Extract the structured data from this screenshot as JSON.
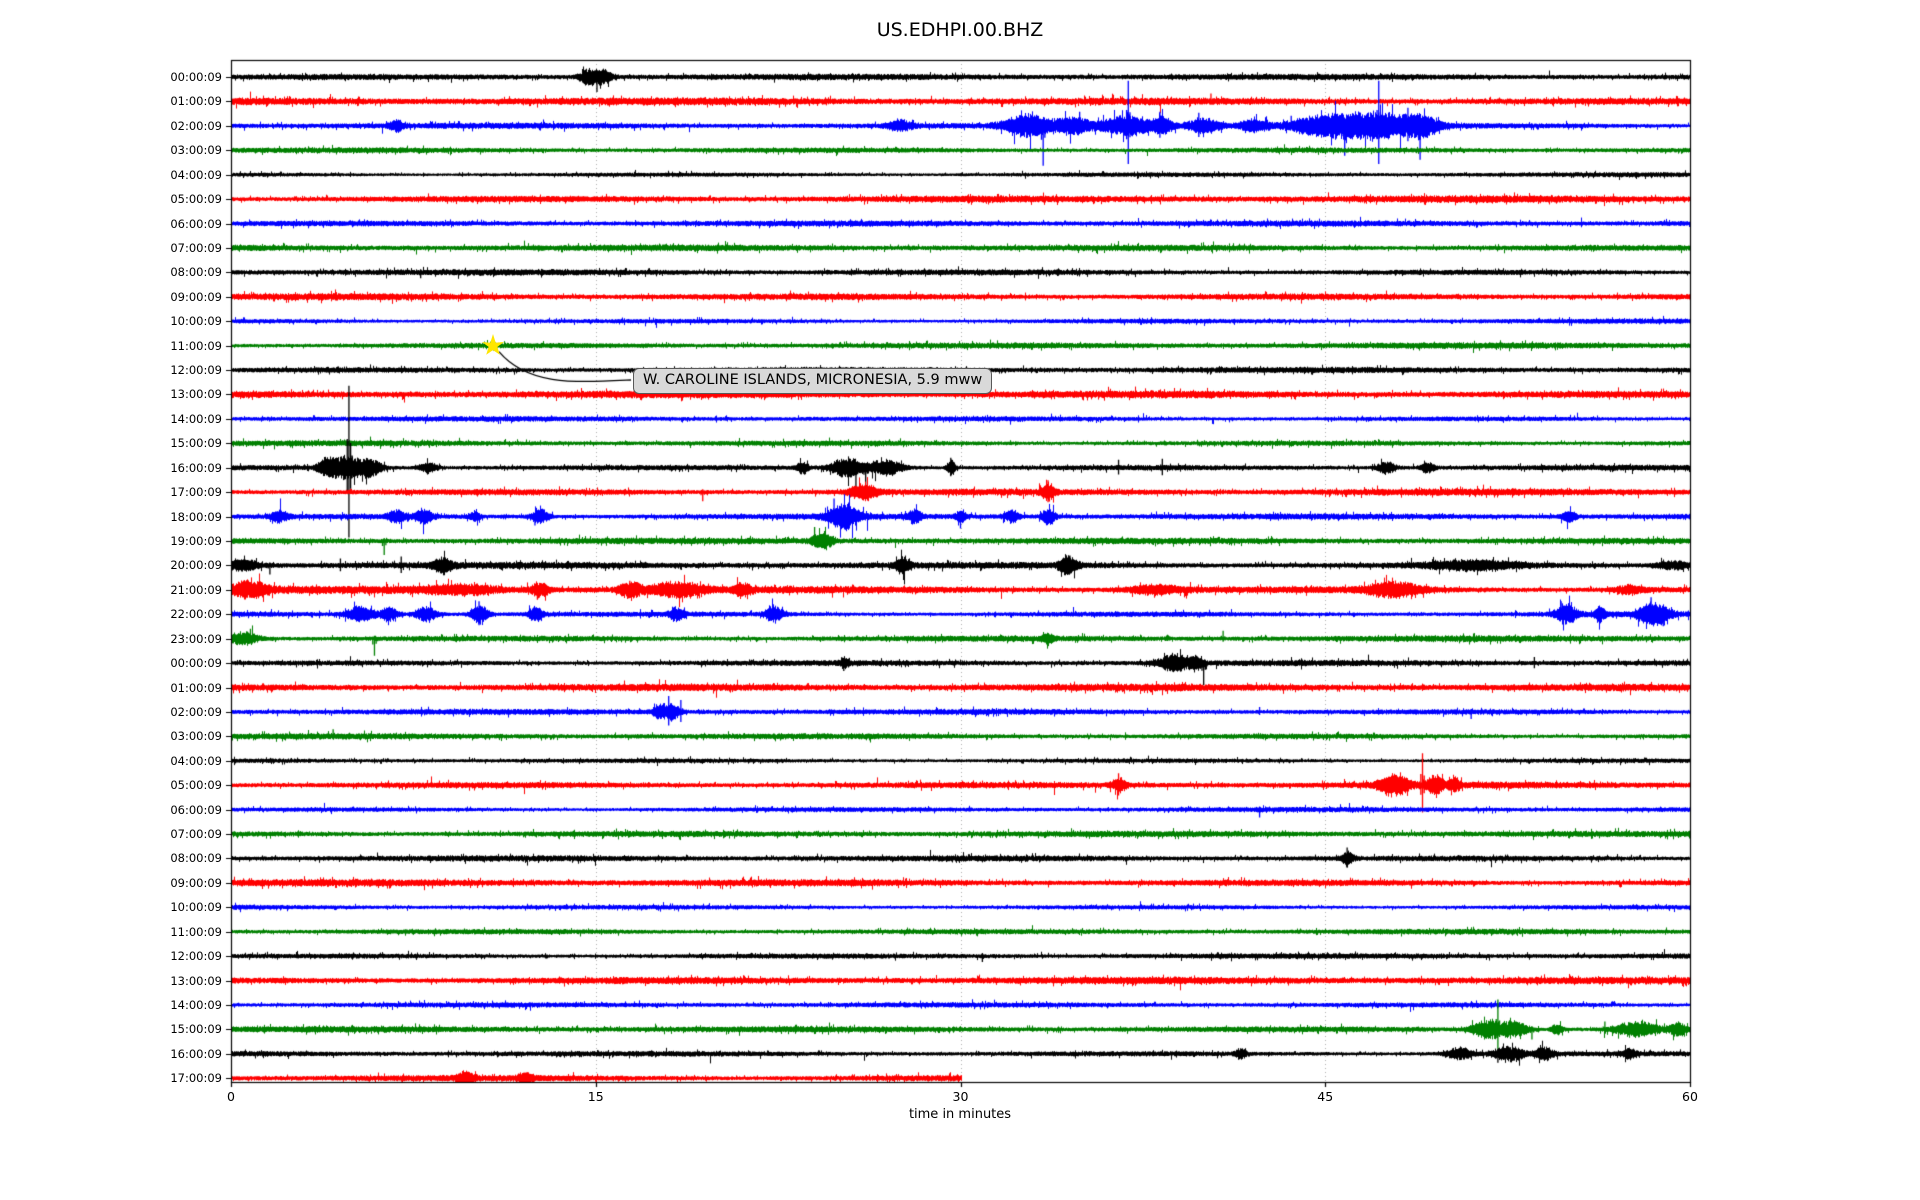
{
  "title": "US.EDHPI.00.BHZ",
  "annotation": {
    "text": "W. CAROLINE ISLANDS, MICRONESIA, 5.9 mww",
    "star_minute": 10.77,
    "star_row": 11
  },
  "axes": {
    "xlabel": "time in minutes",
    "x_ticks": [
      "0",
      "15",
      "30",
      "45",
      "60"
    ],
    "x_tick_minutes": [
      0,
      15,
      30,
      45,
      60
    ],
    "grid_minutes": [
      15,
      30,
      45
    ]
  },
  "colors": {
    "cycle": [
      "#000000",
      "#ff0000",
      "#0000ff",
      "#008000"
    ],
    "grid": "#ababab",
    "axis": "#000000",
    "star_fill": "#ffe600",
    "annotation_bg": "#d9d9d9",
    "annotation_border": "#595959",
    "background": "#ffffff"
  },
  "chart_data": {
    "type": "line",
    "title": "US.EDHPI.00.BHZ",
    "xlabel": "time in minutes",
    "xlim": [
      0,
      60
    ],
    "x_unit": "minutes",
    "row_interval": "1 hour per trace, colors cycle black/red/blue/green",
    "marked_event": {
      "label": "W. CAROLINE ISLANDS, MICRONESIA, 5.9 mww",
      "row": 11,
      "minute": 10.77
    },
    "rows": [
      {
        "label": "00:00:09",
        "color": 0,
        "base": 3.2,
        "xmax": 60,
        "bursts": [
          [
            14.7,
            0.5,
            8
          ],
          [
            15.3,
            0.5,
            7
          ]
        ],
        "spikes": [
          [
            15.05,
            15,
            "down"
          ]
        ]
      },
      {
        "label": "01:00:09",
        "color": 1,
        "base": 4.0,
        "xmax": 60,
        "bursts": [],
        "spikes": [
          [
            40.3,
            8,
            "up"
          ]
        ]
      },
      {
        "label": "02:00:09",
        "color": 2,
        "base": 3.2,
        "xmax": 60,
        "bursts": [
          [
            6.8,
            0.4,
            5
          ],
          [
            27.5,
            0.7,
            5
          ],
          [
            32.8,
            1.4,
            11
          ],
          [
            34.6,
            0.9,
            8
          ],
          [
            36.8,
            1.6,
            10
          ],
          [
            38.3,
            0.6,
            7
          ],
          [
            40.0,
            1.0,
            8
          ],
          [
            42.0,
            0.9,
            6
          ],
          [
            44.8,
            2.0,
            10
          ],
          [
            47.2,
            2.4,
            13
          ],
          [
            49.0,
            0.9,
            8
          ]
        ],
        "spikes": [
          [
            33.4,
            40,
            "down"
          ],
          [
            34.9,
            14,
            "up"
          ],
          [
            36.9,
            45,
            "both"
          ],
          [
            38.2,
            14,
            "both"
          ],
          [
            39.8,
            13,
            "both"
          ],
          [
            43.6,
            10,
            "up"
          ],
          [
            45.5,
            12,
            "both"
          ],
          [
            45.8,
            30,
            "down"
          ],
          [
            47.2,
            45,
            "both"
          ],
          [
            48.4,
            18,
            "both"
          ],
          [
            48.9,
            34,
            "down"
          ]
        ]
      },
      {
        "label": "03:00:09",
        "color": 3,
        "base": 3.2,
        "xmax": 60,
        "bursts": [],
        "spikes": []
      },
      {
        "label": "04:00:09",
        "color": 0,
        "base": 2.6,
        "xmax": 60,
        "bursts": [],
        "spikes": []
      },
      {
        "label": "05:00:09",
        "color": 1,
        "base": 3.8,
        "xmax": 60,
        "bursts": [],
        "spikes": []
      },
      {
        "label": "06:00:09",
        "color": 2,
        "base": 3.1,
        "xmax": 60,
        "bursts": [],
        "spikes": []
      },
      {
        "label": "07:00:09",
        "color": 3,
        "base": 3.3,
        "xmax": 60,
        "bursts": [],
        "spikes": []
      },
      {
        "label": "08:00:09",
        "color": 0,
        "base": 3.3,
        "xmax": 60,
        "bursts": [],
        "spikes": [
          [
            7.8,
            6,
            "down"
          ]
        ]
      },
      {
        "label": "09:00:09",
        "color": 1,
        "base": 3.9,
        "xmax": 60,
        "bursts": [],
        "spikes": []
      },
      {
        "label": "10:00:09",
        "color": 2,
        "base": 2.8,
        "xmax": 60,
        "bursts": [],
        "spikes": []
      },
      {
        "label": "11:00:09",
        "color": 3,
        "base": 3.3,
        "xmax": 60,
        "bursts": [],
        "spikes": []
      },
      {
        "label": "12:00:09",
        "color": 0,
        "base": 3.1,
        "xmax": 60,
        "bursts": [],
        "spikes": []
      },
      {
        "label": "13:00:09",
        "color": 1,
        "base": 3.9,
        "xmax": 60,
        "bursts": [],
        "spikes": []
      },
      {
        "label": "14:00:09",
        "color": 2,
        "base": 2.8,
        "xmax": 60,
        "bursts": [],
        "spikes": []
      },
      {
        "label": "15:00:09",
        "color": 3,
        "base": 3.2,
        "xmax": 60,
        "bursts": [],
        "spikes": []
      },
      {
        "label": "16:00:09",
        "color": 0,
        "base": 3.2,
        "xmax": 60,
        "bursts": [
          [
            3.9,
            0.5,
            8
          ],
          [
            4.7,
            0.8,
            12
          ],
          [
            5.7,
            0.7,
            9
          ],
          [
            8.1,
            0.5,
            5
          ],
          [
            23.5,
            0.3,
            6
          ],
          [
            25.3,
            0.9,
            10
          ],
          [
            26.9,
            1.0,
            8
          ],
          [
            29.6,
            0.25,
            7
          ],
          [
            47.5,
            0.5,
            6
          ],
          [
            49.2,
            0.4,
            5
          ]
        ],
        "spikes": [
          [
            4.85,
            82,
            "both"
          ],
          [
            25.7,
            22,
            "down"
          ],
          [
            26.1,
            20,
            "down"
          ],
          [
            29.6,
            10,
            "both"
          ],
          [
            36.5,
            8,
            "both"
          ],
          [
            38.3,
            9,
            "both"
          ]
        ]
      },
      {
        "label": "17:00:09",
        "color": 1,
        "base": 3.8,
        "xmax": 60,
        "bursts": [
          [
            26.0,
            0.8,
            7
          ],
          [
            33.6,
            0.35,
            8
          ]
        ],
        "spikes": [
          [
            19.4,
            9,
            "down"
          ],
          [
            33.6,
            12,
            "both"
          ]
        ]
      },
      {
        "label": "18:00:09",
        "color": 2,
        "base": 3.1,
        "xmax": 60,
        "bursts": [
          [
            2.0,
            0.5,
            5
          ],
          [
            6.8,
            0.5,
            6
          ],
          [
            7.9,
            0.5,
            7
          ],
          [
            10.0,
            0.3,
            5
          ],
          [
            12.7,
            0.5,
            7
          ],
          [
            25.2,
            0.9,
            12
          ],
          [
            28.1,
            0.4,
            6
          ],
          [
            30.0,
            0.3,
            5
          ],
          [
            32.1,
            0.4,
            6
          ],
          [
            33.6,
            0.4,
            8
          ],
          [
            55.0,
            0.4,
            5
          ]
        ],
        "spikes": [
          [
            12.5,
            9,
            "down"
          ],
          [
            24.8,
            18,
            "up"
          ],
          [
            25.4,
            14,
            "both"
          ],
          [
            30.0,
            12,
            "down"
          ]
        ]
      },
      {
        "label": "19:00:09",
        "color": 3,
        "base": 3.3,
        "xmax": 60,
        "bursts": [
          [
            24.3,
            0.6,
            8
          ]
        ],
        "spikes": [
          [
            6.3,
            14,
            "down"
          ],
          [
            24.0,
            14,
            "up"
          ]
        ]
      },
      {
        "label": "20:00:09",
        "color": 0,
        "base": 3.5,
        "xmax": 60,
        "bursts": [
          [
            0.5,
            0.9,
            5
          ],
          [
            8.7,
            0.5,
            7
          ],
          [
            27.6,
            0.4,
            8
          ],
          [
            34.4,
            0.5,
            9
          ],
          [
            51.0,
            2.5,
            4
          ],
          [
            59.3,
            1.0,
            4
          ]
        ],
        "spikes": [
          [
            1.6,
            9,
            "down"
          ],
          [
            4.5,
            7,
            "both"
          ],
          [
            7.0,
            9,
            "both"
          ],
          [
            34.5,
            10,
            "both"
          ]
        ]
      },
      {
        "label": "21:00:09",
        "color": 1,
        "base": 4.2,
        "xmax": 60,
        "bursts": [
          [
            0.7,
            1.1,
            7
          ],
          [
            9.5,
            2.0,
            4
          ],
          [
            12.7,
            0.5,
            7
          ],
          [
            16.4,
            0.6,
            8
          ],
          [
            18.3,
            1.6,
            7
          ],
          [
            21.0,
            0.5,
            6
          ],
          [
            38.0,
            1.5,
            4
          ],
          [
            47.8,
            1.6,
            7
          ],
          [
            57.5,
            0.8,
            4
          ]
        ],
        "spikes": [
          [
            12.6,
            10,
            "down"
          ],
          [
            16.4,
            9,
            "both"
          ]
        ]
      },
      {
        "label": "22:00:09",
        "color": 2,
        "base": 3.1,
        "xmax": 60,
        "bursts": [
          [
            5.3,
            0.8,
            8
          ],
          [
            6.5,
            0.5,
            7
          ],
          [
            8.0,
            0.6,
            8
          ],
          [
            10.2,
            0.5,
            9
          ],
          [
            12.5,
            0.4,
            7
          ],
          [
            18.3,
            0.4,
            6
          ],
          [
            22.3,
            0.5,
            8
          ],
          [
            54.9,
            0.6,
            10
          ],
          [
            56.3,
            0.3,
            7
          ],
          [
            58.5,
            0.9,
            11
          ]
        ],
        "spikes": [
          [
            10.2,
            13,
            "both"
          ],
          [
            22.3,
            10,
            "up"
          ],
          [
            54.7,
            13,
            "up"
          ],
          [
            58.4,
            17,
            "up"
          ],
          [
            58.9,
            12,
            "down"
          ]
        ]
      },
      {
        "label": "23:00:09",
        "color": 3,
        "base": 3.5,
        "xmax": 60,
        "bursts": [
          [
            0.5,
            0.9,
            6
          ],
          [
            33.6,
            0.3,
            5
          ]
        ],
        "spikes": [
          [
            0.8,
            10,
            "up"
          ],
          [
            5.9,
            17,
            "down"
          ],
          [
            40.8,
            8,
            "up"
          ]
        ]
      },
      {
        "label": "00:00:09",
        "color": 0,
        "base": 3.1,
        "xmax": 60,
        "bursts": [
          [
            25.2,
            0.25,
            5
          ],
          [
            38.8,
            0.9,
            8
          ],
          [
            39.7,
            0.35,
            6
          ]
        ],
        "spikes": [
          [
            25.2,
            8,
            "down"
          ],
          [
            40.0,
            22,
            "down"
          ],
          [
            53.6,
            6,
            "both"
          ]
        ]
      },
      {
        "label": "01:00:09",
        "color": 1,
        "base": 3.8,
        "xmax": 60,
        "bursts": [],
        "spikes": []
      },
      {
        "label": "02:00:09",
        "color": 2,
        "base": 3.0,
        "xmax": 60,
        "bursts": [
          [
            17.6,
            0.35,
            7
          ],
          [
            18.1,
            0.45,
            8
          ]
        ],
        "spikes": [
          [
            18.0,
            16,
            "both"
          ],
          [
            18.5,
            12,
            "both"
          ],
          [
            42.3,
            5,
            "up"
          ],
          [
            51.0,
            7,
            "down"
          ]
        ]
      },
      {
        "label": "03:00:09",
        "color": 3,
        "base": 3.2,
        "xmax": 60,
        "bursts": [],
        "spikes": [
          [
            4.2,
            7,
            "up"
          ]
        ]
      },
      {
        "label": "04:00:09",
        "color": 0,
        "base": 2.7,
        "xmax": 60,
        "bursts": [],
        "spikes": []
      },
      {
        "label": "05:00:09",
        "color": 1,
        "base": 3.8,
        "xmax": 60,
        "bursts": [
          [
            36.5,
            0.4,
            6
          ],
          [
            47.8,
            0.9,
            9
          ],
          [
            49.5,
            0.5,
            8
          ],
          [
            50.3,
            0.3,
            6
          ]
        ],
        "spikes": [
          [
            36.5,
            12,
            "both"
          ],
          [
            49.0,
            32,
            "both"
          ]
        ]
      },
      {
        "label": "06:00:09",
        "color": 2,
        "base": 2.7,
        "xmax": 60,
        "bursts": [],
        "spikes": [
          [
            42.3,
            8,
            "down"
          ]
        ]
      },
      {
        "label": "07:00:09",
        "color": 3,
        "base": 3.2,
        "xmax": 60,
        "bursts": [],
        "spikes": []
      },
      {
        "label": "08:00:09",
        "color": 0,
        "base": 3.1,
        "xmax": 60,
        "bursts": [
          [
            45.9,
            0.35,
            6
          ]
        ],
        "spikes": [
          [
            45.9,
            11,
            "both"
          ]
        ]
      },
      {
        "label": "09:00:09",
        "color": 1,
        "base": 3.8,
        "xmax": 60,
        "bursts": [],
        "spikes": []
      },
      {
        "label": "10:00:09",
        "color": 2,
        "base": 2.7,
        "xmax": 60,
        "bursts": [],
        "spikes": []
      },
      {
        "label": "11:00:09",
        "color": 3,
        "base": 3.2,
        "xmax": 60,
        "bursts": [],
        "spikes": []
      },
      {
        "label": "12:00:09",
        "color": 0,
        "base": 3.0,
        "xmax": 60,
        "bursts": [],
        "spikes": [
          [
            30.9,
            6,
            "down"
          ]
        ]
      },
      {
        "label": "13:00:09",
        "color": 1,
        "base": 3.8,
        "xmax": 60,
        "bursts": [],
        "spikes": []
      },
      {
        "label": "14:00:09",
        "color": 2,
        "base": 2.7,
        "xmax": 60,
        "bursts": [],
        "spikes": []
      },
      {
        "label": "15:00:09",
        "color": 3,
        "base": 3.3,
        "xmax": 60,
        "bursts": [
          [
            51.7,
            0.9,
            10
          ],
          [
            52.8,
            0.7,
            8
          ],
          [
            54.5,
            0.35,
            5
          ],
          [
            57.8,
            1.3,
            7
          ],
          [
            59.5,
            0.5,
            6
          ]
        ],
        "spikes": [
          [
            52.1,
            30,
            "both"
          ],
          [
            53.5,
            10,
            "down"
          ],
          [
            56.5,
            8,
            "up"
          ]
        ]
      },
      {
        "label": "16:00:09",
        "color": 0,
        "base": 3.1,
        "xmax": 60,
        "bursts": [
          [
            41.5,
            0.3,
            5
          ],
          [
            50.5,
            0.7,
            6
          ],
          [
            52.5,
            0.9,
            7
          ],
          [
            54.0,
            0.5,
            6
          ],
          [
            57.5,
            0.35,
            5
          ]
        ],
        "spikes": [
          [
            52.1,
            9,
            "down"
          ]
        ]
      },
      {
        "label": "17:00:09",
        "color": 1,
        "base": 3.8,
        "xmax": 30,
        "bursts": [
          [
            9.6,
            0.5,
            5
          ],
          [
            12.1,
            0.4,
            5
          ]
        ],
        "spikes": []
      }
    ]
  }
}
